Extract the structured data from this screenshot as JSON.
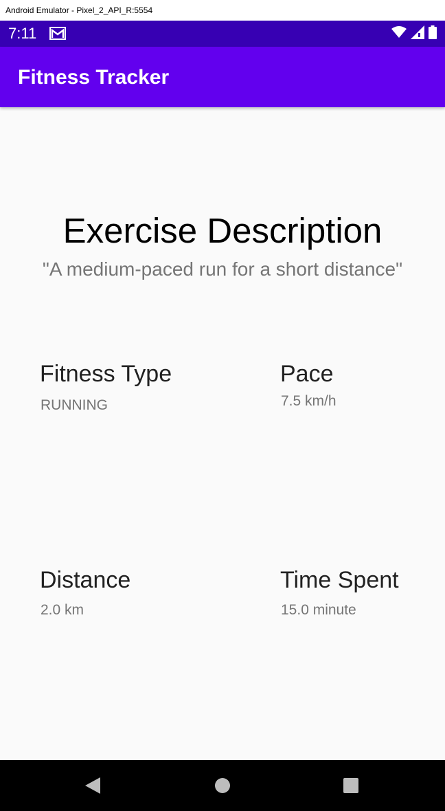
{
  "window": {
    "title": "Android Emulator - Pixel_2_API_R:5554"
  },
  "status_bar": {
    "time": "7:11",
    "left_icons": [
      "mail-icon"
    ],
    "right_icons": [
      "wifi-icon",
      "signal-icon",
      "battery-icon"
    ]
  },
  "app_bar": {
    "title": "Fitness Tracker"
  },
  "exercise": {
    "heading": "Exercise Description",
    "description": "\"A medium-paced run for a short distance\""
  },
  "stats": {
    "fitness_type": {
      "label": "Fitness Type",
      "value": "RUNNING"
    },
    "pace": {
      "label": "Pace",
      "value": "7.5 km/h"
    },
    "distance": {
      "label": "Distance",
      "value": "2.0 km"
    },
    "time_spent": {
      "label": "Time Spent",
      "value": "15.0 minute"
    }
  },
  "nav_bar": {
    "icons": [
      "back-icon",
      "home-icon",
      "recents-icon"
    ]
  },
  "colors": {
    "status_bar": "#3700b3",
    "app_bar": "#6200ee",
    "background": "#fafafa",
    "secondary_text": "#757575"
  }
}
